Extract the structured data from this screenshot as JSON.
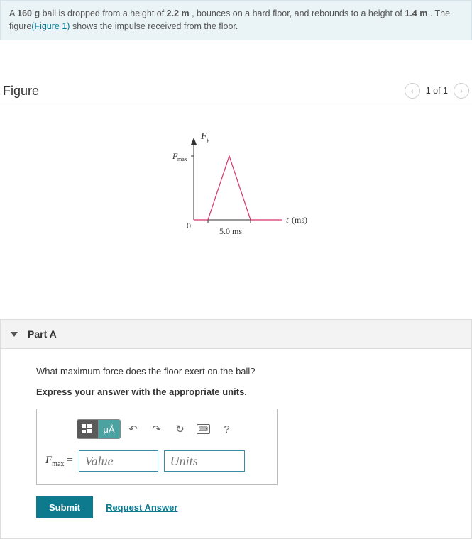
{
  "problem": {
    "text_before_mass": "A ",
    "mass": "160 g",
    "text_after_mass": " ball is dropped from a height of ",
    "height1": "2.2 m",
    "text_after_h1": " , bounces on a hard floor, and rebounds to a height of ",
    "height2": "1.4 m",
    "text_after_h2": " . The figure",
    "figure_link_label": "(Figure 1)",
    "text_tail": " shows the impulse received from the floor."
  },
  "figure_section": {
    "title": "Figure",
    "pager_text": "1 of 1"
  },
  "chart_data": {
    "type": "line",
    "x_unit": "ms",
    "y_axis_label_html": "F_y",
    "y_tick_label_html": "F_max",
    "x_tick_label": "5.0 ms",
    "x_axis_label": "t (ms)",
    "x_origin_label": "0",
    "xlim": [
      0,
      7
    ],
    "ylim": [
      0,
      1
    ],
    "description": "Triangular impulse: force rises linearly from 0 at t≈1 ms to F_max at t≈3 ms, falls linearly back to 0 at t≈5 ms; total base width 5.0 ms.",
    "points_relative": [
      {
        "t_ms": 0.0,
        "F_over_Fmax": 0.0
      },
      {
        "t_ms": 1.0,
        "F_over_Fmax": 0.0
      },
      {
        "t_ms": 3.0,
        "F_over_Fmax": 1.0
      },
      {
        "t_ms": 5.0,
        "F_over_Fmax": 0.0
      },
      {
        "t_ms": 7.0,
        "F_over_Fmax": 0.0
      }
    ]
  },
  "part": {
    "title": "Part A",
    "question": "What maximum force does the floor exert on the ball?",
    "instruction": "Express your answer with the appropriate units.",
    "lhs_symbol": "F",
    "lhs_subscript": "max",
    "equals": "=",
    "value_placeholder": "Value",
    "units_placeholder": "Units",
    "toolbar": {
      "template_label": "tmpl",
      "greek_label": "μÅ",
      "undo_label": "↶",
      "redo_label": "↷",
      "reset_label": "↻",
      "keyboard_label": "kbd",
      "help_label": "?"
    },
    "submit_label": "Submit",
    "request_label": "Request Answer"
  }
}
